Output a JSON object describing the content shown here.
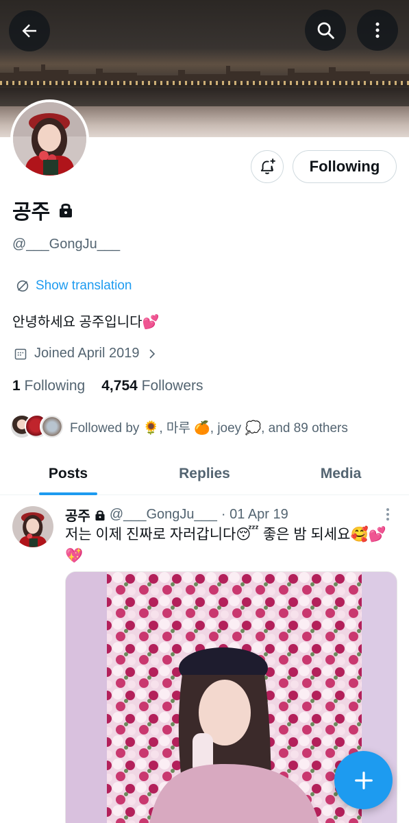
{
  "profile": {
    "display_name": "공주",
    "handle": "@___GongJu___",
    "show_translation": "Show translation",
    "bio": "안녕하세요 공주입니다💕",
    "joined": "Joined April 2019",
    "following_count": "1",
    "following_label": "Following",
    "followers_count": "4,754",
    "followers_label": "Followers",
    "follow_button": "Following",
    "followed_by": "Followed by 🌻, 마루 🍊, joey 💭, and 89 others"
  },
  "tabs": [
    {
      "label": "Posts",
      "active": true
    },
    {
      "label": "Replies",
      "active": false
    },
    {
      "label": "Media",
      "active": false
    }
  ],
  "post": {
    "name": "공주",
    "handle": "@___GongJu___",
    "date": "· 01 Apr 19",
    "text": "저는 이제 진짜로 자러갑니다😴 좋은 밤 되세요🥰💕💖"
  },
  "icons": {
    "back": "arrow-left-icon",
    "search": "search-icon",
    "more": "more-vertical-icon",
    "notify": "bell-plus-icon",
    "lock": "lock-icon",
    "translate": "translate-icon",
    "calendar": "calendar-icon",
    "compose": "plus-icon"
  },
  "colors": {
    "accent": "#1d9bf0",
    "text": "#0f1419",
    "muted": "#536471"
  }
}
